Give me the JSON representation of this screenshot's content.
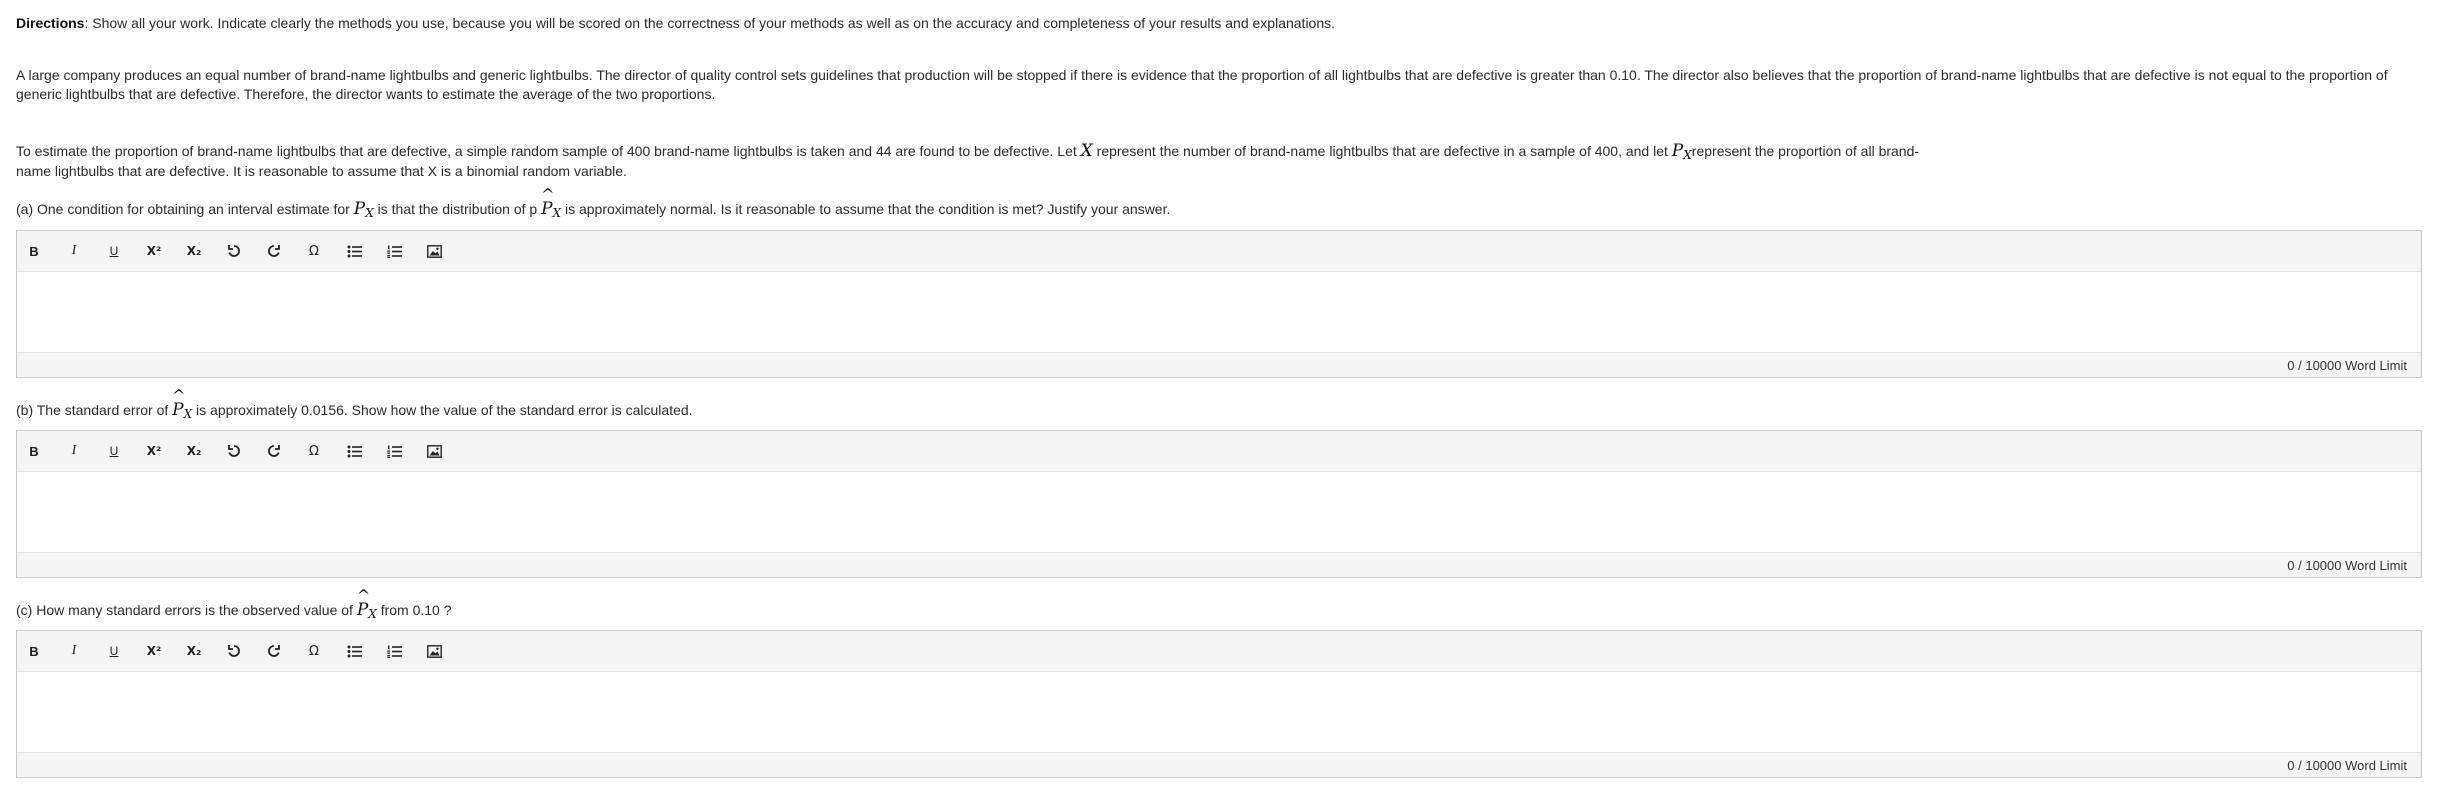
{
  "directions": {
    "label": "Directions",
    "text": ": Show all your work. Indicate clearly the methods you use, because you will be scored on the correctness of your methods as well as on the accuracy and completeness of your results and explanations."
  },
  "paragraph1": "A large company produces an equal number of brand-name lightbulbs and generic lightbulbs. The director of quality control sets guidelines that production will be stopped if there is evidence that the proportion of all lightbulbs that are defective is greater than 0.10. The director also believes that the proportion of brand-name lightbulbs that are defective is not equal to the proportion of generic lightbulbs that are defective. Therefore, the director wants to estimate the average of the two proportions.",
  "paragraph2": {
    "part1": "To estimate the proportion of brand-name lightbulbs that are defective, a simple random sample of 400 brand-name lightbulbs is taken and 44 are found to be defective. Let ",
    "var_x": "X",
    "part2": " represent the number of brand-name lightbulbs that are defective in a sample of 400, and let ",
    "var_p": "P",
    "var_p_sub": "X",
    "part3": "represent the proportion of all brand-name lightbulbs that are defective. It is reasonable to assume that X is a binomial random variable."
  },
  "questions": [
    {
      "prefix": "(a) One condition for obtaining an interval estimate for ",
      "mid": " is that the distribution of p ",
      "suffix": " is approximately normal. Is it reasonable to assume that the condition is met? Justify your answer.",
      "var": "P",
      "sub": "X",
      "word_limit": "0 / 10000 Word Limit"
    },
    {
      "prefix": "(b) The standard error of ",
      "suffix": " is approximately 0.0156. Show how the value of the standard error is calculated.",
      "var": "P",
      "sub": "X",
      "word_limit": "0 / 10000 Word Limit"
    },
    {
      "prefix": "(c) How many standard errors is the observed value of ",
      "suffix": " from 0.10 ?",
      "var": "P",
      "sub": "X",
      "word_limit": "0 / 10000 Word Limit"
    }
  ],
  "hat_glyph": "^",
  "toolbar": {
    "bold": "B",
    "italic": "I",
    "underline": "U",
    "superscript": "X²",
    "subscript": "X₂",
    "special_char": "Ω",
    "icons": [
      "bold-icon",
      "italic-icon",
      "underline-icon",
      "superscript-icon",
      "subscript-icon",
      "undo-icon",
      "redo-icon",
      "omega-icon",
      "bulleted-list-icon",
      "numbered-list-icon",
      "image-icon"
    ]
  }
}
